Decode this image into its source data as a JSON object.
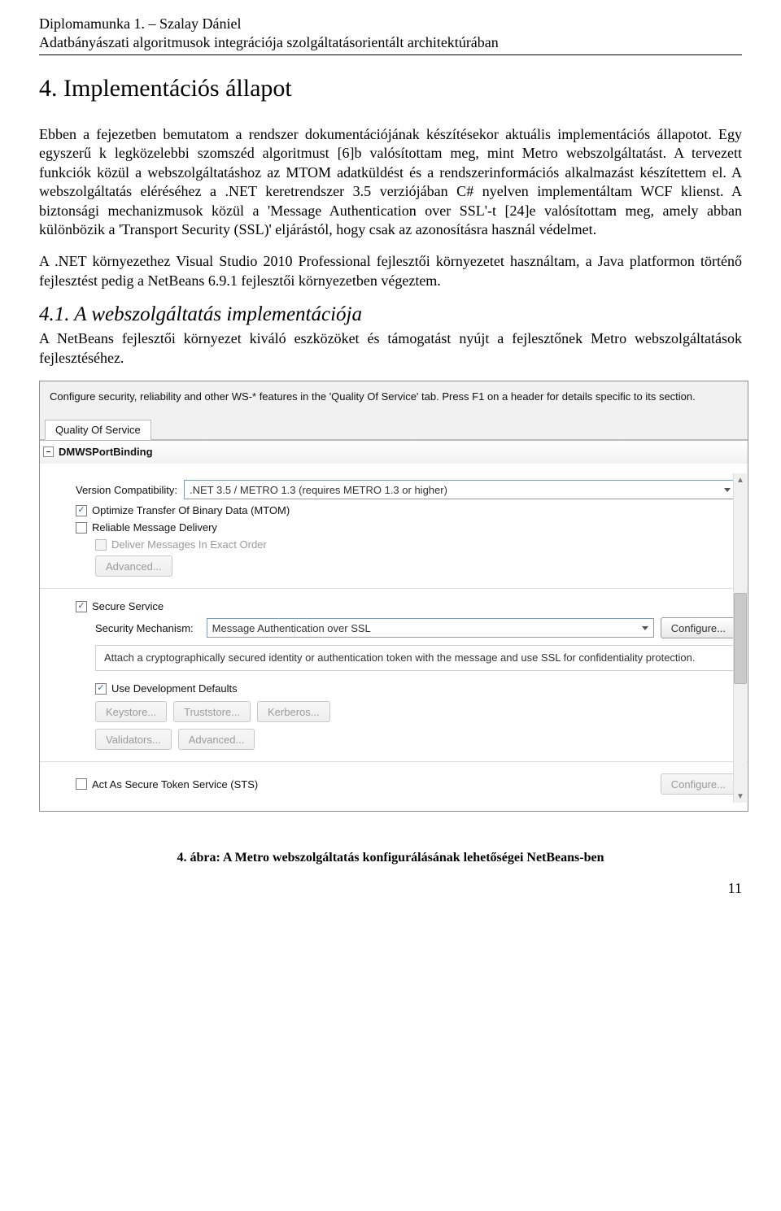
{
  "header": {
    "line1": "Diplomamunka 1. – Szalay Dániel",
    "line2": "Adatbányászati algoritmusok integrációja szolgáltatásorientált architektúrában"
  },
  "section_title": "4. Implementációs állapot",
  "para1": "Ebben a fejezetben bemutatom a rendszer dokumentációjának készítésekor aktuális implementációs állapotot. Egy egyszerű k legközelebbi szomszéd algoritmust [6]b valósítottam meg, mint Metro webszolgáltatást. A tervezett funkciók közül a webszolgáltatáshoz az MTOM adatküldést és a rendszerinformációs alkalmazást készítettem el. A webszolgáltatás eléréséhez a .NET keretrendszer 3.5 verziójában C# nyelven implementáltam WCF klienst. A biztonsági mechanizmusok közül a 'Message Authentication over SSL'-t [24]e valósítottam meg, amely abban különbözik a 'Transport Security (SSL)' eljárástól, hogy csak az azonosításra használ védelmet.",
  "para2": "A .NET környezethez Visual Studio 2010 Professional fejlesztői környezetet használtam, a Java platformon történő fejlesztést pedig a NetBeans 6.9.1 fejlesztői környezetben végeztem.",
  "subsection_title": "4.1. A webszolgáltatás implementációja",
  "para3": "A NetBeans fejlesztői környezet kiváló eszközöket és támogatást nyújt a fejlesztőnek Metro webszolgáltatások fejlesztéséhez.",
  "nb": {
    "instruction": "Configure security, reliability and other WS-* features in the 'Quality Of Service' tab. Press F1 on a header for details specific to its section.",
    "tab_label": "Quality Of Service",
    "binding_name": "DMWSPortBinding",
    "version_label": "Version Compatibility:",
    "version_value": ".NET 3.5 / METRO 1.3 (requires METRO 1.3 or higher)",
    "chk_mtom": "Optimize Transfer Of Binary Data (MTOM)",
    "chk_reliable": "Reliable Message Delivery",
    "chk_exact_order": "Deliver Messages In Exact Order",
    "btn_advanced": "Advanced...",
    "chk_secure": "Secure Service",
    "sec_mech_label": "Security Mechanism:",
    "sec_mech_value": "Message Authentication over SSL",
    "btn_configure": "Configure...",
    "sec_desc": "Attach a cryptographically secured identity or authentication token with the message and use SSL for confidentiality protection.",
    "chk_dev_defaults": "Use Development Defaults",
    "btn_keystore": "Keystore...",
    "btn_truststore": "Truststore...",
    "btn_kerberos": "Kerberos...",
    "btn_validators": "Validators...",
    "btn_advanced2": "Advanced...",
    "chk_sts": "Act As Secure Token Service (STS)",
    "btn_configure2": "Configure..."
  },
  "figure_caption": "4. ábra: A Metro webszolgáltatás konfigurálásának lehetőségei NetBeans-ben",
  "page_number": "11"
}
